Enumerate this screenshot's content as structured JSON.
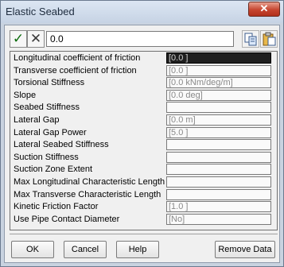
{
  "window": {
    "title": "Elastic Seabed",
    "close_glyph": "✕"
  },
  "toolbar": {
    "accept_glyph": "✓",
    "cancel_glyph": "✕",
    "edit_value": "0.0",
    "copy_icon": "copy-icon",
    "paste_icon": "paste-icon"
  },
  "properties": [
    {
      "name": "Longitudinal coefficient of friction",
      "value": "[0.0 ]"
    },
    {
      "name": "Transverse coefficient of friction",
      "value": "[0.0 ]"
    },
    {
      "name": "Torsional Stiffness",
      "value": "[0.0 kNm/deg/m]"
    },
    {
      "name": "Slope",
      "value": "[0.0 deg]"
    },
    {
      "name": "Seabed Stiffness",
      "value": ""
    },
    {
      "name": "Lateral Gap",
      "value": "[0.0 m]"
    },
    {
      "name": "Lateral Gap Power",
      "value": "[5.0 ]"
    },
    {
      "name": "Lateral Seabed Stiffness",
      "value": ""
    },
    {
      "name": "Suction Stiffness",
      "value": ""
    },
    {
      "name": "Suction Zone Extent",
      "value": ""
    },
    {
      "name": "Max Longitudinal Characteristic Length",
      "value": ""
    },
    {
      "name": "Max Transverse Characteristic Length",
      "value": ""
    },
    {
      "name": "Kinetic Friction Factor",
      "value": "[1.0 ]"
    },
    {
      "name": "Use Pipe Contact Diameter",
      "value": "[No]"
    }
  ],
  "buttons": {
    "ok": "OK",
    "cancel": "Cancel",
    "help": "Help",
    "remove": "Remove Data"
  }
}
